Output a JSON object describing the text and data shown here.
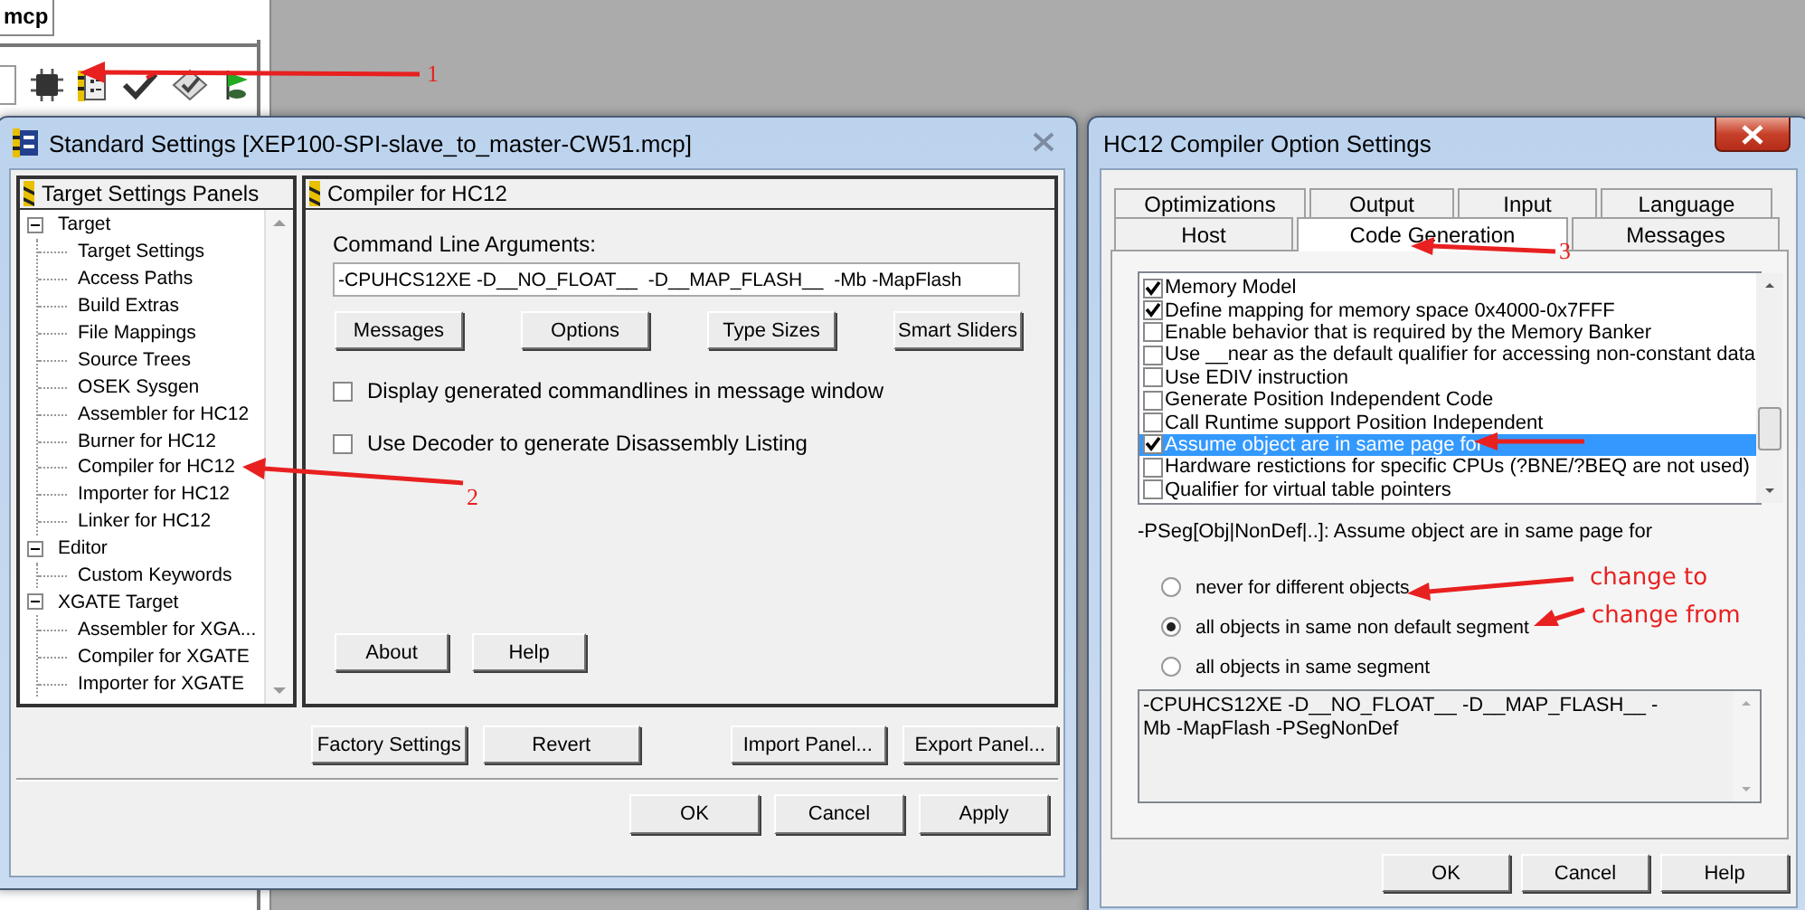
{
  "ide": {
    "tab": "mcp"
  },
  "settings": {
    "title": "Standard Settings [XEP100-SPI-slave_to_master-CW51.mcp]",
    "tree_title": "Target Settings Panels",
    "tree": [
      {
        "label": "Target",
        "expanded": true,
        "children": [
          {
            "label": "Target Settings"
          },
          {
            "label": "Access Paths"
          },
          {
            "label": "Build Extras"
          },
          {
            "label": "File Mappings"
          },
          {
            "label": "Source Trees"
          },
          {
            "label": "OSEK Sysgen"
          },
          {
            "label": "Assembler for HC12"
          },
          {
            "label": "Burner for HC12"
          },
          {
            "label": "Compiler for HC12"
          },
          {
            "label": "Importer for HC12"
          },
          {
            "label": "Linker for HC12"
          }
        ]
      },
      {
        "label": "Editor",
        "expanded": true,
        "children": [
          {
            "label": "Custom Keywords"
          }
        ]
      },
      {
        "label": "XGATE Target",
        "expanded": true,
        "children": [
          {
            "label": "Assembler for XGA..."
          },
          {
            "label": "Compiler for XGATE"
          },
          {
            "label": "Importer for XGATE"
          }
        ]
      }
    ],
    "panel": {
      "title": "Compiler for HC12",
      "args_label": "Command Line Arguments:",
      "args_value": "-CPUHCS12XE -D__NO_FLOAT__  -D__MAP_FLASH__  -Mb -MapFlash",
      "buttons": [
        "Messages",
        "Options",
        "Type Sizes",
        "Smart Sliders"
      ],
      "checkboxes": [
        {
          "label": "Display generated commandlines in message window",
          "checked": false
        },
        {
          "label": "Use Decoder to generate Disassembly Listing",
          "checked": false
        }
      ],
      "footer_buttons": [
        "About",
        "Help"
      ]
    },
    "panel_buttons": [
      "Factory Settings",
      "Revert",
      "Import Panel...",
      "Export Panel..."
    ],
    "buttons": [
      "OK",
      "Cancel",
      "Apply"
    ]
  },
  "options": {
    "title": "HC12 Compiler Option Settings",
    "tabs_back": [
      {
        "label": "Optimizations",
        "selected": false
      },
      {
        "label": "Output",
        "selected": false
      },
      {
        "label": "Input",
        "selected": false
      },
      {
        "label": "Language",
        "selected": false
      }
    ],
    "tabs_front": [
      {
        "label": "Host",
        "selected": false
      },
      {
        "label": "Code Generation",
        "selected": true
      },
      {
        "label": "Messages",
        "selected": false
      }
    ],
    "items": [
      {
        "label": "Memory Model",
        "checked": true,
        "selected": false
      },
      {
        "label": "Define mapping for memory space 0x4000-0x7FFF",
        "checked": true,
        "selected": false
      },
      {
        "label": "Enable behavior that is required by the Memory Banker",
        "checked": false,
        "selected": false
      },
      {
        "label": "Use __near as the default qualifier for accessing non-constant data",
        "checked": false,
        "selected": false
      },
      {
        "label": "Use EDIV instruction",
        "checked": false,
        "selected": false
      },
      {
        "label": "Generate Position Independent Code",
        "checked": false,
        "selected": false
      },
      {
        "label": "Call Runtime support Position Independent",
        "checked": false,
        "selected": false
      },
      {
        "label": "Assume object are in same page for",
        "checked": true,
        "selected": true
      },
      {
        "label": "Hardware restictions for specific CPUs (?BNE/?BEQ are not used)",
        "checked": false,
        "selected": false
      },
      {
        "label": "Qualifier for virtual table pointers",
        "checked": false,
        "selected": false
      }
    ],
    "description": "-PSeg[Obj|NonDef|..]: Assume object are in same page for",
    "radios": [
      {
        "label": "never for different objects",
        "selected": false
      },
      {
        "label": "all objects in same non default segment",
        "selected": true
      },
      {
        "label": "all objects in same segment",
        "selected": false
      }
    ],
    "command_line": "-CPUHCS12XE -D__NO_FLOAT__ -D__MAP_FLASH__ -Mb -MapFlash -PSegNonDef",
    "buttons": [
      "OK",
      "Cancel",
      "Help"
    ]
  },
  "annotations": [
    {
      "label": "1"
    },
    {
      "label": "2"
    },
    {
      "label": "3"
    },
    {
      "label": "change to"
    },
    {
      "label": "change from"
    }
  ]
}
